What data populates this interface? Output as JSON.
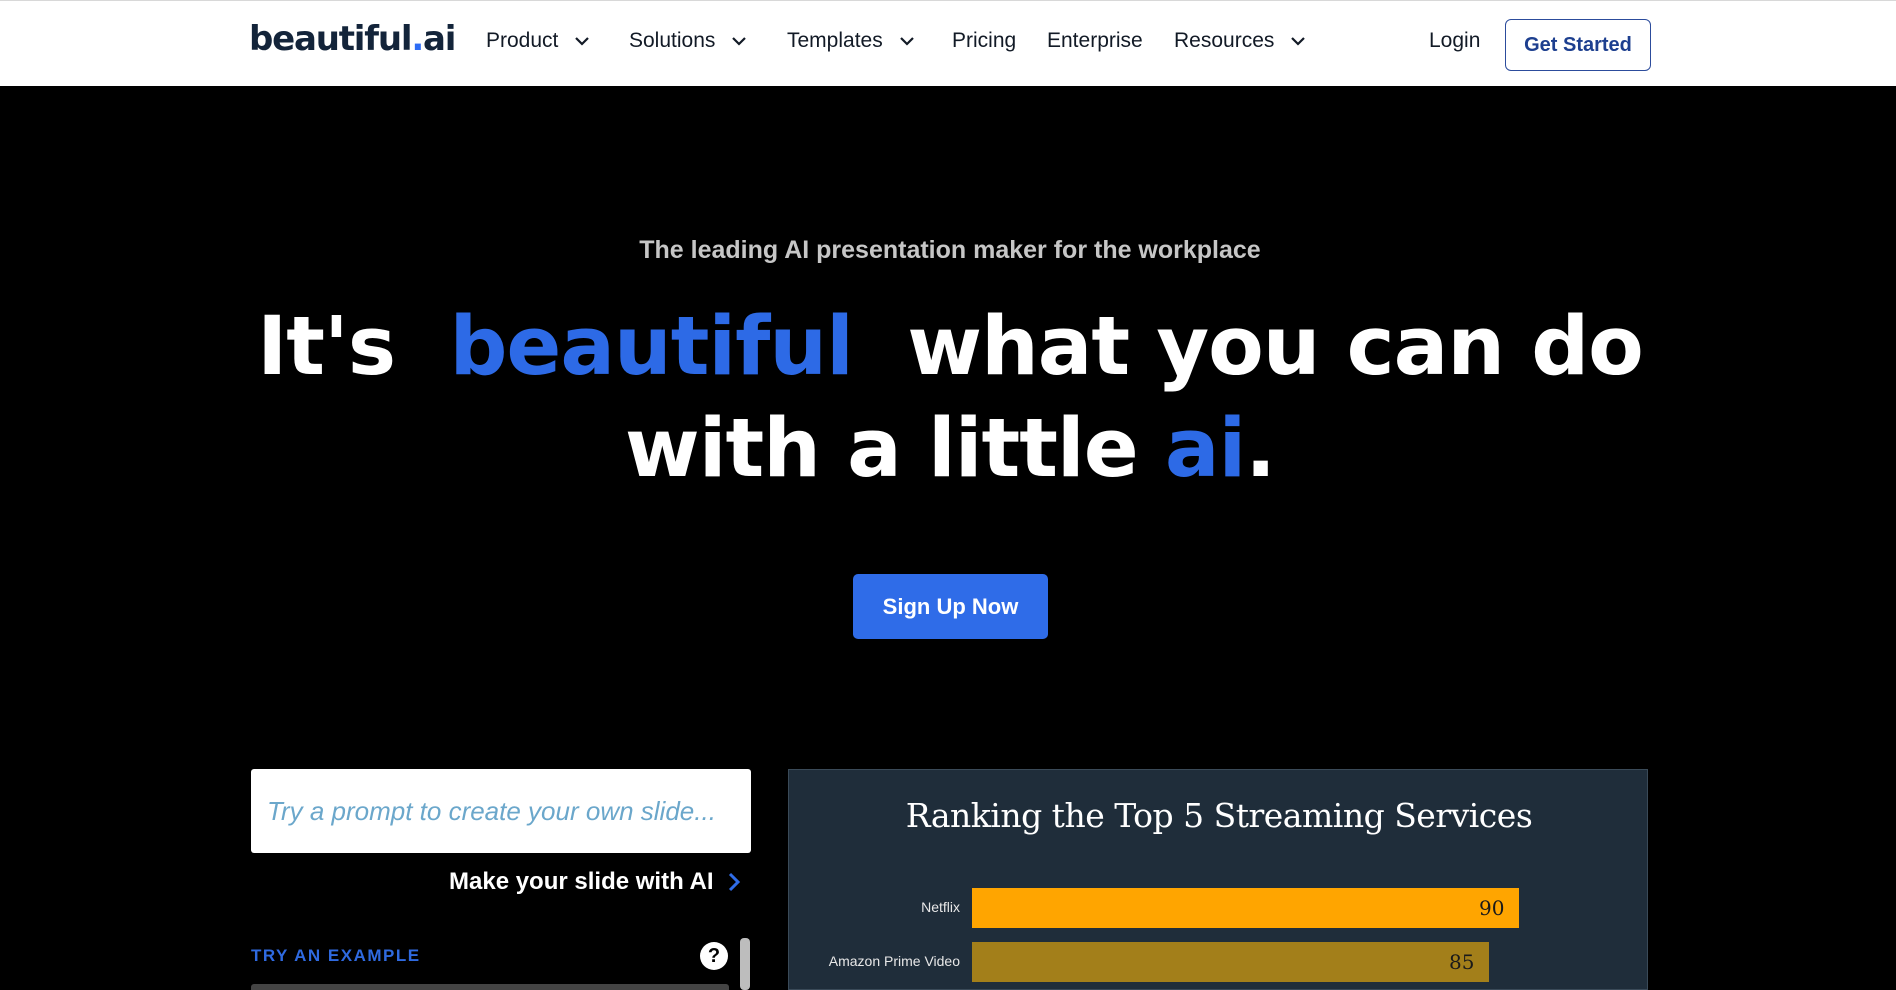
{
  "nav": {
    "logo_main": "beautiful",
    "logo_dot": ".",
    "logo_suffix": "ai",
    "items": [
      {
        "label": "Product",
        "dropdown": true
      },
      {
        "label": "Solutions",
        "dropdown": true
      },
      {
        "label": "Templates",
        "dropdown": true
      },
      {
        "label": "Pricing",
        "dropdown": false
      },
      {
        "label": "Enterprise",
        "dropdown": false
      },
      {
        "label": "Resources",
        "dropdown": true
      }
    ],
    "login": "Login",
    "get_started": "Get Started"
  },
  "hero": {
    "tagline": "The leading AI presentation maker for the workplace",
    "title_part1": "It's",
    "title_accent1": "beautiful",
    "title_part2": "what you can do",
    "title_part3": "with a little",
    "title_accent2": "ai",
    "title_period": ".",
    "signup": "Sign Up Now"
  },
  "prompt": {
    "placeholder": "Try a prompt to create your own slide...",
    "make_slide": "Make your slide with AI",
    "try_example": "TRY AN EXAMPLE",
    "help": "?"
  },
  "slide_preview": {
    "title": "Ranking the Top 5 Streaming Services"
  },
  "chart_data": {
    "type": "bar",
    "title": "Ranking the Top 5 Streaming Services",
    "categories": [
      "Netflix",
      "Amazon Prime Video"
    ],
    "values": [
      90,
      85
    ],
    "colors": [
      "#ffa500",
      "#a37f1a"
    ],
    "xlabel": "",
    "ylabel": ""
  },
  "colors": {
    "accent": "#2f6ce8",
    "nav_bg": "#ffffff",
    "hero_bg": "#000000",
    "slide_bg": "#1f2d3a"
  },
  "icons": {
    "dropdown": "chevron-down-icon",
    "arrow": "chevron-right-icon",
    "help": "question-circle-icon"
  }
}
